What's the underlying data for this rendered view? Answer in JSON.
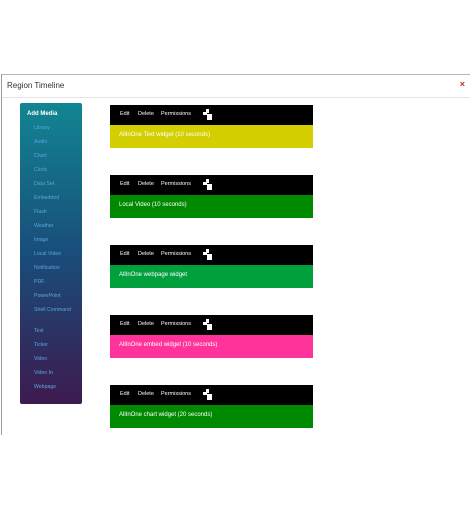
{
  "modal": {
    "title": "Region Timeline",
    "close": "×"
  },
  "sidebar": {
    "header": "Add Media",
    "items": [
      {
        "label": "Library"
      },
      {
        "label": "Audio"
      },
      {
        "label": "Chart"
      },
      {
        "label": "Clock"
      },
      {
        "label": "Data Set"
      },
      {
        "label": "Embedded"
      },
      {
        "label": "Flash"
      },
      {
        "label": "Weather"
      },
      {
        "label": "Image"
      },
      {
        "label": "Local Video"
      },
      {
        "label": "Notification"
      },
      {
        "label": "PDF"
      },
      {
        "label": "PowerPoint"
      },
      {
        "label": "Shell Command"
      },
      {
        "label": "Text"
      },
      {
        "label": "Ticker"
      },
      {
        "label": "Video"
      },
      {
        "label": "Video In"
      },
      {
        "label": "Webpage"
      }
    ]
  },
  "toolbar": {
    "edit": "Edit",
    "delete": "Delete",
    "permissions": "Permissions",
    "icon": "region-preview-icon"
  },
  "widgets": [
    {
      "label": "AllInOne Text widget (10 seconds)",
      "color": "#d3cf00"
    },
    {
      "label": "Local Video (10 seconds)",
      "color": "#008a00"
    },
    {
      "label": "AllInOne webpage widget",
      "color": "#00a03c"
    },
    {
      "label": "AllInOne embed widget (10 seconds)",
      "color": "#ff3399"
    },
    {
      "label": "AllInOne chart widget (20 seconds)",
      "color": "#008a00"
    }
  ]
}
